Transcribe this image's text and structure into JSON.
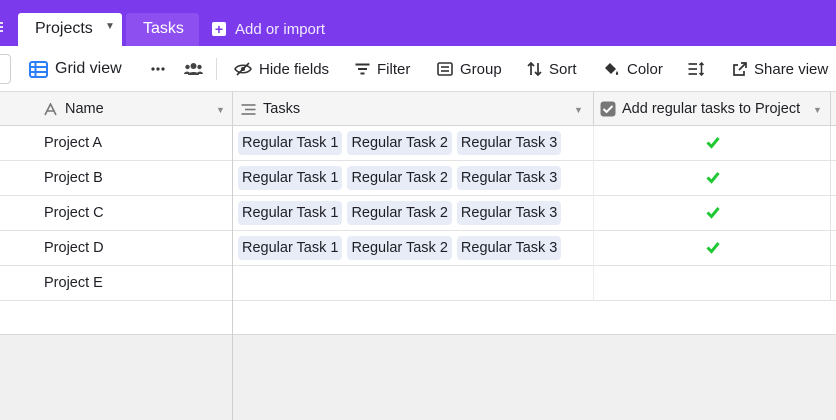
{
  "tabs": [
    {
      "label": "Projects",
      "active": true
    },
    {
      "label": "Tasks",
      "active": false
    }
  ],
  "add_import_label": "Add or import",
  "toolbar": {
    "view_name": "Grid view",
    "hide_fields": "Hide fields",
    "filter": "Filter",
    "group": "Group",
    "sort": "Sort",
    "color": "Color",
    "share_view": "Share view"
  },
  "columns": {
    "name": "Name",
    "tasks": "Tasks",
    "add_regular": "Add regular tasks to Project"
  },
  "rows": [
    {
      "name": "Project A",
      "tasks": [
        "Regular Task 1",
        "Regular Task 2",
        "Regular Task 3"
      ],
      "checked": true
    },
    {
      "name": "Project B",
      "tasks": [
        "Regular Task 1",
        "Regular Task 2",
        "Regular Task 3"
      ],
      "checked": true
    },
    {
      "name": "Project C",
      "tasks": [
        "Regular Task 1",
        "Regular Task 2",
        "Regular Task 3"
      ],
      "checked": true
    },
    {
      "name": "Project D",
      "tasks": [
        "Regular Task 1",
        "Regular Task 2",
        "Regular Task 3"
      ],
      "checked": true
    },
    {
      "name": "Project E",
      "tasks": [],
      "checked": false
    }
  ],
  "colors": {
    "brand": "#7c3aed",
    "chip": "#e7ecf7",
    "check": "#20c933",
    "grid_icon": "#2d7ff9"
  },
  "icons": {
    "grid_view": "grid-icon",
    "more": "more-icon",
    "collaborators": "people-icon",
    "hide_fields": "eye-slash-icon",
    "filter": "filter-icon",
    "group": "group-icon",
    "sort": "sort-icon",
    "color": "paint-bucket-icon",
    "row_height": "row-height-icon",
    "share_view": "share-icon"
  }
}
